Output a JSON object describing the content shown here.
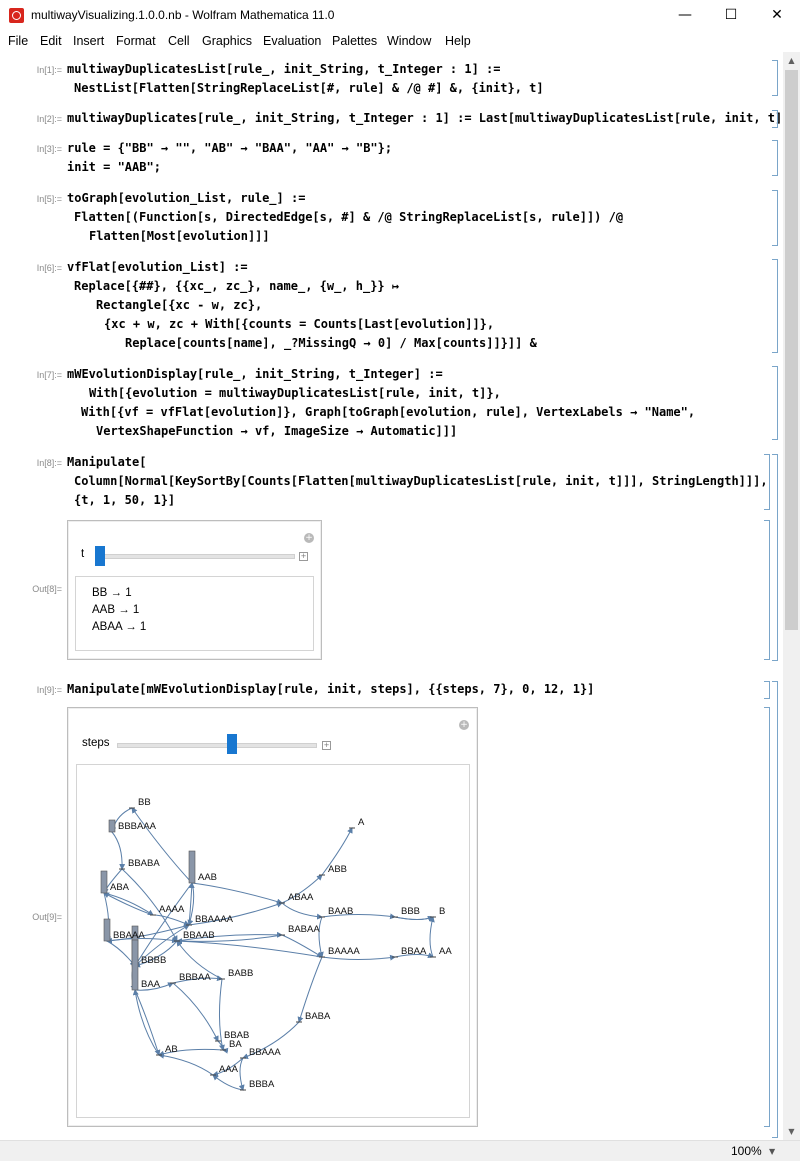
{
  "window": {
    "title": "multiwayVisualizing.1.0.0.nb - Wolfram Mathematica 11.0",
    "minimize": "—",
    "maximize": "☐",
    "close": "✕"
  },
  "menu": [
    "File",
    "Edit",
    "Insert",
    "Format",
    "Cell",
    "Graphics",
    "Evaluation",
    "Palettes",
    "Window",
    "Help"
  ],
  "cells": {
    "in1": {
      "label": "In[1]:=",
      "line1": "multiwayDuplicatesList[rule_, init_String, t_Integer : 1] :=",
      "line2": "NestList[Flatten[StringReplaceList[#, rule] & /@ #] &, {init}, t]"
    },
    "in2": {
      "label": "In[2]:=",
      "line1": "multiwayDuplicates[rule_, init_String, t_Integer : 1] := Last[multiwayDuplicatesList[rule, init, t]]"
    },
    "in3": {
      "label": "In[3]:=",
      "line1": "rule = {\"BB\" → \"\", \"AB\" → \"BAA\", \"AA\" → \"B\"};",
      "line2": "init = \"AAB\";"
    },
    "in5": {
      "label": "In[5]:=",
      "line1": "toGraph[evolution_List, rule_] :=",
      "line2": "Flatten[(Function[s, DirectedEdge[s, #] & /@ StringReplaceList[s, rule]]) /@",
      "line3": "Flatten[Most[evolution]]]"
    },
    "in6": {
      "label": "In[6]:=",
      "line1": "vfFlat[evolution_List] :=",
      "line2": "Replace[{##}, {{xc_, zc_}, name_, {w_, h_}} ↦",
      "line3": "Rectangle[{xc - w, zc},",
      "line4": "{xc + w, zc + With[{counts = Counts[Last[evolution]]},",
      "line5": "Replace[counts[name], _?MissingQ → 0] / Max[counts]]}]] &"
    },
    "in7": {
      "label": "In[7]:=",
      "line1": "mWEvolutionDisplay[rule_, init_String, t_Integer] :=",
      "line2": "With[{evolution = multiwayDuplicatesList[rule, init, t]},",
      "line3": "With[{vf = vfFlat[evolution]}, Graph[toGraph[evolution, rule], VertexLabels → \"Name\",",
      "line4": "VertexShapeFunction → vf, ImageSize → Automatic]]]"
    },
    "in8": {
      "label": "In[8]:=",
      "line1": "Manipulate[",
      "line2": "Column[Normal[KeySortBy[Counts[Flatten[multiwayDuplicatesList[rule, init, t]]], StringLength]]],",
      "line3": "{t, 1, 50, 1}]"
    },
    "out8": {
      "label": "Out[8]=",
      "control": "t",
      "slider_value": 1,
      "slider_min": 1,
      "slider_max": 50,
      "rows": [
        "BB → 1",
        "AAB → 1",
        "ABAA → 1"
      ]
    },
    "in9": {
      "label": "In[9]:=",
      "line1": "Manipulate[mWEvolutionDisplay[rule, init, steps], {{steps, 7}, 0, 12, 1}]"
    },
    "out9": {
      "label": "Out[9]=",
      "control": "steps",
      "slider_value": 7,
      "slider_min": 0,
      "slider_max": 12
    }
  },
  "graph": {
    "edge_color": "#5b7fa8",
    "vertex_color": "#8a96a8",
    "vertices": [
      "BB",
      "BBBAAA",
      "BBABA",
      "ABA",
      "AAB",
      "AAAA",
      "BBAAAA",
      "BBAAA",
      "BBAAB",
      "BBBB",
      "BAA",
      "BBBAA",
      "BABB",
      "BABAA",
      "ABAA",
      "ABB",
      "A",
      "BAAB",
      "BAAAA",
      "BBB",
      "B",
      "BBAA",
      "AA",
      "BABA",
      "BBAB",
      "BA",
      "AB",
      "AAA",
      "BBAAA2",
      "BBBA"
    ],
    "vertex_labels": {
      "BB": "BB",
      "BBBAAA": "BBBAAA",
      "BBABA": "BBABA",
      "ABA": "ABA",
      "AAB": "AAB",
      "AAAA": "AAAA",
      "BBAAAA": "BBAAAA",
      "BBAAA": "BBAAA",
      "BBAAB": "BBAAB",
      "BBBB": "BBBB",
      "BAA": "BAA",
      "BBBAA": "BBBAA",
      "BABB": "BABB",
      "BABAA": "BABAA",
      "ABAA": "ABAA",
      "ABB": "ABB",
      "A": "A",
      "BAAB": "BAAB",
      "BAAAA": "BAAAA",
      "BBB": "BBB",
      "B": "B",
      "BBAA": "BBAA",
      "AA": "AA",
      "BABA": "BABA",
      "BBAB": "BBAB",
      "BA": "BA",
      "AB": "AB",
      "AAA": "AAA",
      "BBAAA2": "BBAAA",
      "BBBA": "BBBA"
    }
  },
  "status": {
    "zoom": "100%"
  }
}
